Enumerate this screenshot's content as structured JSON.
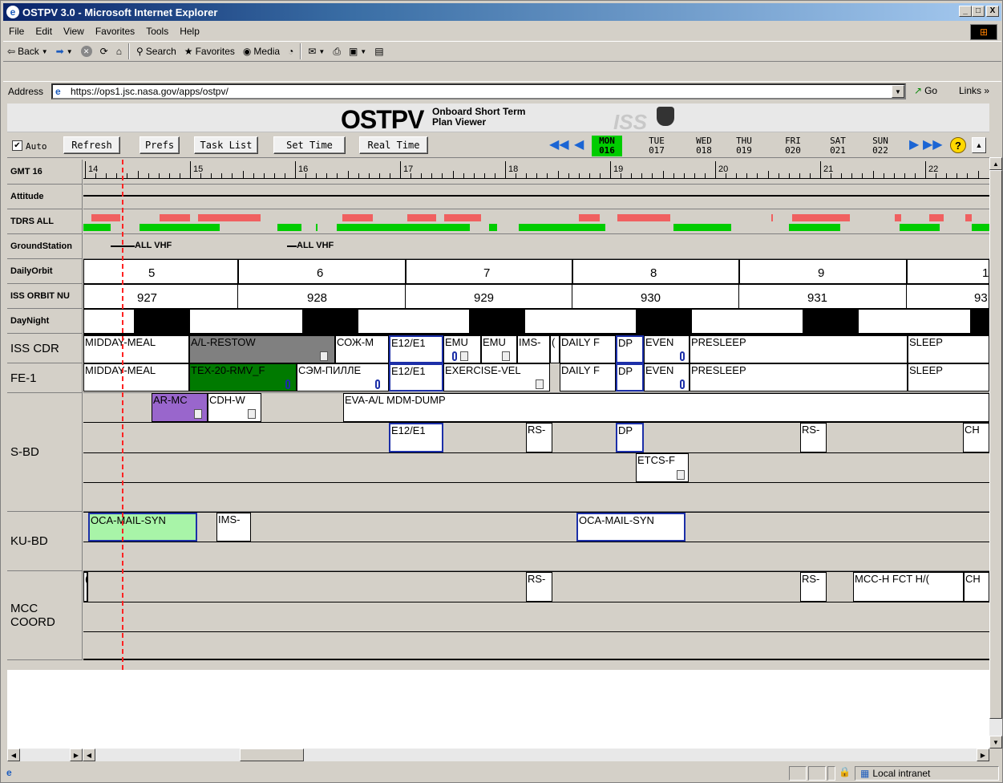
{
  "window": {
    "title": "OSTPV 3.0 - Microsoft Internet Explorer",
    "min": "_",
    "max": "□",
    "close": "X"
  },
  "menu": [
    "File",
    "Edit",
    "View",
    "Favorites",
    "Tools",
    "Help"
  ],
  "toolbar": {
    "back": "Back",
    "search": "Search",
    "favorites": "Favorites",
    "media": "Media"
  },
  "address": {
    "label": "Address",
    "url": "https://ops1.jsc.nasa.gov/apps/ostpv/",
    "go": "Go",
    "links": "Links »"
  },
  "app": {
    "logo": "OSTPV",
    "subtitle_line1": "Onboard Short Term",
    "subtitle_line2": "Plan Viewer",
    "iss": "ISS"
  },
  "controls": {
    "auto_label": "Auto",
    "auto_checked": true,
    "refresh": "Refresh",
    "prefs": "Prefs",
    "task_list": "Task List",
    "set_time": "Set Time",
    "real_time": "Real Time",
    "help": "?"
  },
  "days": [
    {
      "name": "MON",
      "num": "016",
      "selected": true
    },
    {
      "name": "TUE",
      "num": "017",
      "selected": false
    },
    {
      "name": "WED",
      "num": "018",
      "selected": false
    },
    {
      "name": "THU",
      "num": "019",
      "selected": false
    },
    {
      "name": "FRI",
      "num": "020",
      "selected": false
    },
    {
      "name": "SAT",
      "num": "021",
      "selected": false
    },
    {
      "name": "SUN",
      "num": "022",
      "selected": false
    }
  ],
  "rows": {
    "gmt": "GMT 16",
    "attitude": "Attitude",
    "tdrs": "TDRS ALL",
    "ground": "GroundStation",
    "daily_orbit": "DailyOrbit",
    "iss_orbit": "ISS ORBIT NU",
    "day_night": "DayNight",
    "iss_cdr": "ISS CDR",
    "fe1": "FE-1",
    "sbd": "S-BD",
    "kubd": "KU-BD",
    "mcc_line1": "MCC",
    "mcc_line2": "COORD"
  },
  "hours": [
    "14",
    "15",
    "16",
    "17",
    "18",
    "19",
    "20",
    "21",
    "22"
  ],
  "ground_labels": [
    "ALL VHF",
    "ALL VHF"
  ],
  "daily_orbits": [
    "5",
    "6",
    "7",
    "8",
    "9",
    "1"
  ],
  "iss_orbits": [
    "927",
    "928",
    "929",
    "930",
    "931",
    "93"
  ],
  "cdr": [
    "MIDDAY-MEAL",
    "A/L-RESTOW",
    "СОЖ-М",
    "E12/E1",
    "EMU",
    "EMU",
    "IMS-",
    "(",
    "DAILY F",
    "DP",
    "EVEN",
    "PRESLEEP",
    "SLEEP"
  ],
  "fe1": [
    "MIDDAY-MEAL",
    "TEX-20-RMV_F",
    "СЭМ-ПИЛЛЕ",
    "E12/E1",
    "EXERCISE-VEL",
    "DAILY F",
    "DP",
    "EVEN",
    "PRESLEEP",
    "SLEEP"
  ],
  "sbd1": [
    "AR-MC",
    "CDH-W",
    "EVA-A/L MDM-DUMP"
  ],
  "sbd2": [
    "E12/E1",
    "RS-",
    "DP",
    "RS-",
    "CH"
  ],
  "sbd3": [
    "ETCS-F"
  ],
  "kubd": [
    "OCA-MAIL-SYN",
    "IMS-",
    "OCA-MAIL-SYN"
  ],
  "mcc": [
    "(",
    "RS-",
    "RS-",
    "MCC-H FCT H/(",
    "CH"
  ],
  "status": {
    "zone": "Local intranet"
  },
  "colors": {
    "tdrs_red": "#f06060",
    "tdrs_green": "#00cc00",
    "selected_day": "#00cc00",
    "block_blue_border": "#1c2fa8",
    "cursor": "#ff2222"
  }
}
